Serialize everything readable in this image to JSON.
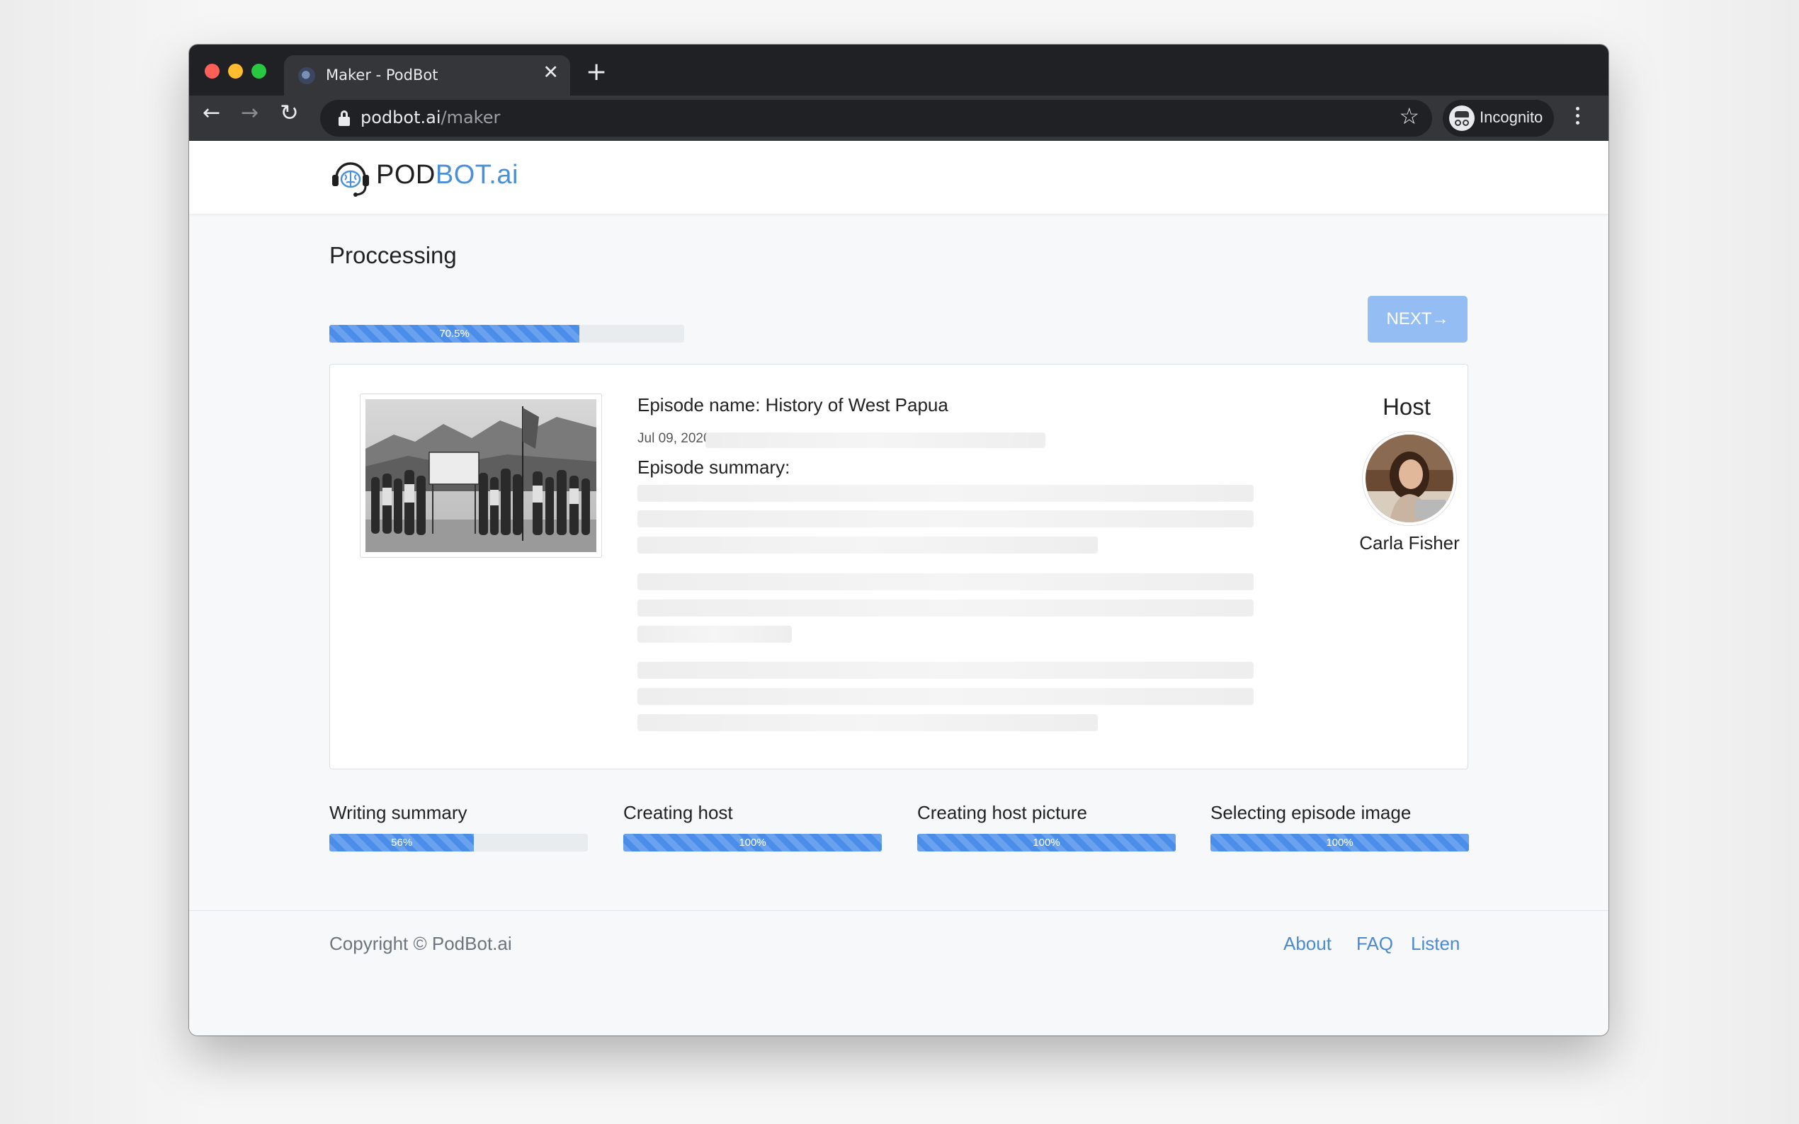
{
  "browser": {
    "tab_title": "Maker - PodBot",
    "url_host": "podbot.ai",
    "url_path": "/maker",
    "profile_label": "Incognito"
  },
  "brand": {
    "logo_part1": "POD",
    "logo_part2": "BOT.ai",
    "accent_color": "#4a90d9"
  },
  "processing": {
    "title": "Proccessing",
    "progress_label": "70.5%",
    "progress_value": 0.705,
    "next_label": "NEXT→"
  },
  "episode": {
    "name": "Episode name: History of West Papua",
    "date": "Jul 09, 2020",
    "summary_label": "Episode summary:",
    "host_heading": "Host",
    "host_name": "Carla Fisher"
  },
  "steps": [
    {
      "label": "Writing summary",
      "value_label": "56%",
      "value": 0.56
    },
    {
      "label": "Creating host",
      "value_label": "100%",
      "value": 1.0
    },
    {
      "label": "Creating host picture",
      "value_label": "100%",
      "value": 1.0
    },
    {
      "label": "Selecting episode image",
      "value_label": "100%",
      "value": 1.0
    }
  ],
  "footer": {
    "copyright": "Copyright © PodBot.ai",
    "links": [
      "About",
      "FAQ",
      "Listen"
    ]
  },
  "icons": {
    "back": "arrow-left-icon",
    "forward": "arrow-right-icon",
    "reload": "reload-icon",
    "lock": "lock-icon",
    "bookmark": "star-icon",
    "incognito": "incognito-icon",
    "menu": "kebab-menu-icon",
    "close_tab": "close-icon",
    "new_tab": "plus-icon"
  }
}
